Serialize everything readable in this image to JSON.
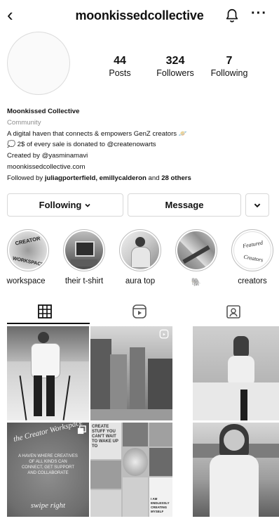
{
  "header": {
    "back_icon": "chevron-left-icon",
    "username": "moonkissedcollective",
    "bell_icon": "bell-icon",
    "more_icon": "more-icon"
  },
  "stats": [
    {
      "value": "44",
      "label": "Posts"
    },
    {
      "value": "324",
      "label": "Followers"
    },
    {
      "value": "7",
      "label": "Following"
    }
  ],
  "bio": {
    "name": "Moonkissed Collective",
    "category": "Community",
    "line1": "A digital haven that connects & empowers GenZ creators 🪐",
    "line2": "💭 2$ of every sale is donated to @createnowarts",
    "line3": "Created by @yasminamavi",
    "link": "moonkissedcollective.com",
    "followed_prefix": "Followed by ",
    "followed_names": "juliagporterfield, emillycalderon",
    "followed_mid": " and ",
    "followed_others": "28 others"
  },
  "actions": {
    "following": "Following",
    "message": "Message"
  },
  "highlights": [
    {
      "label": "workspace"
    },
    {
      "label": "their t-shirt"
    },
    {
      "label": "aura top"
    },
    {
      "label": "🐘"
    },
    {
      "label": "creators"
    }
  ],
  "highlight_art": {
    "workspace_text": "CREATOR WORKSPACE",
    "creators_text": "Featured Creators"
  },
  "tabs": [
    "grid-icon",
    "reels-icon",
    "tagged-icon"
  ],
  "posts": [
    {
      "alt": "person skiing in snow",
      "text": ""
    },
    {
      "alt": "city street",
      "text": ""
    },
    {
      "alt": "mirror selfie",
      "text": ""
    },
    {
      "alt": "the creator workspace",
      "text": "the Creator Workspace",
      "sub": "A HAVEN WHERE CREATIVES OF ALL KINDS CAN CONNECT, GET SUPPORT AND COLLABORATE",
      "foot": "swipe right"
    },
    {
      "alt": "collage",
      "text": "CREATE STUFF YOU CAN'T WAIT TO WAKE UP TO",
      "foot": "I AM ENDLESSLY CREATING MYSELF"
    },
    {
      "alt": "person in t-shirt",
      "text": ""
    }
  ]
}
